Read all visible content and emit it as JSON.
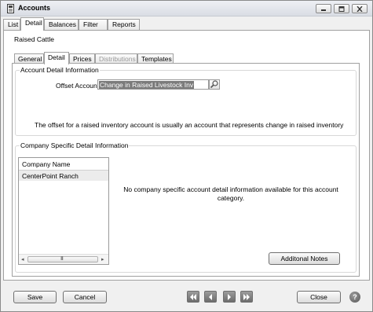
{
  "window": {
    "title": "Accounts",
    "icon": "book-icon"
  },
  "main_tabs": [
    {
      "label": "List"
    },
    {
      "label": "Detail",
      "active": true
    },
    {
      "label": "Balances"
    },
    {
      "label": "Filter"
    },
    {
      "label": "Reports"
    }
  ],
  "record_title": "Raised Cattle",
  "sub_tabs": [
    {
      "label": "General"
    },
    {
      "label": "Detail",
      "active": true
    },
    {
      "label": "Prices"
    },
    {
      "label": "Distributions",
      "disabled": true
    },
    {
      "label": "Templates"
    }
  ],
  "account_detail": {
    "group_title": "Account Detail Information",
    "offset_label": "Offset Account",
    "offset_value": "Change in Raised Livestock Inv",
    "note": "The offset for a raised inventory account is usually an account that represents change in raised inventory"
  },
  "company_detail": {
    "group_title": "Company Specific Detail Information",
    "list_header": "Company Name",
    "companies": [
      "CenterPoint Ranch"
    ],
    "scroll_grip": "III",
    "no_info_text": "No company specific account detail information available for this account category.",
    "notes_button": "Additonal Notes"
  },
  "footer": {
    "save_label": "Save",
    "cancel_label": "Cancel",
    "close_label": "Close",
    "help_label": "?"
  }
}
